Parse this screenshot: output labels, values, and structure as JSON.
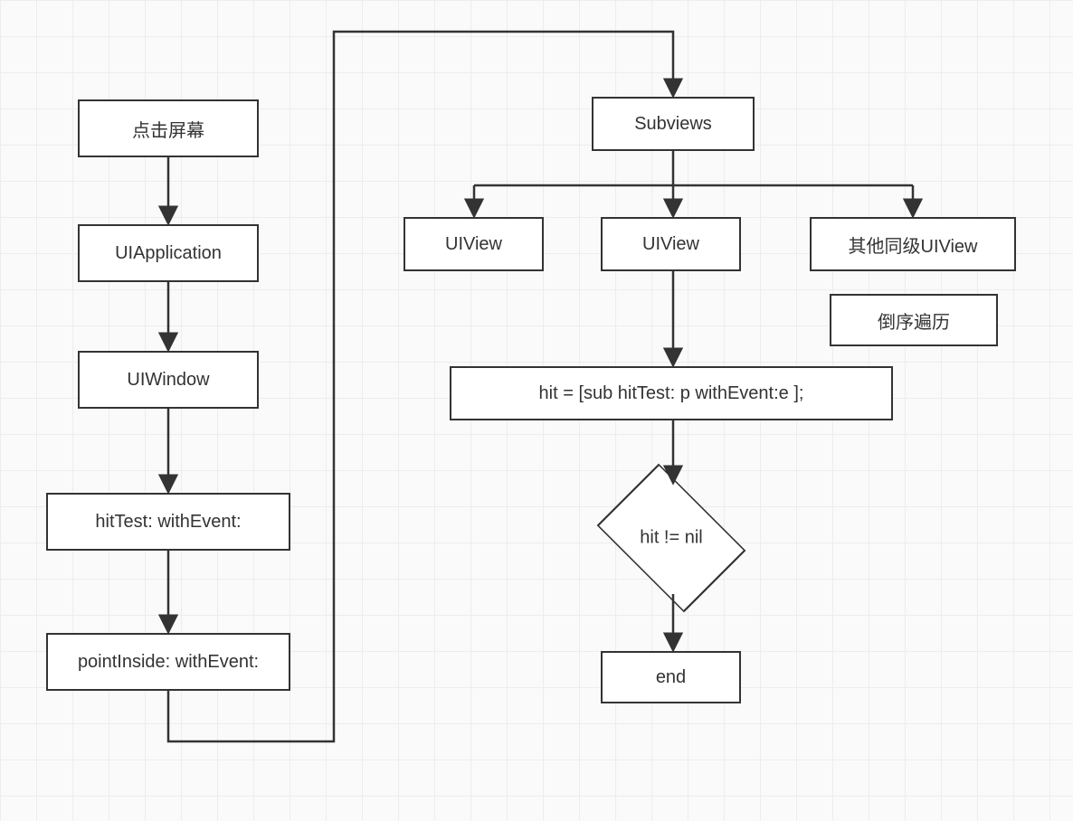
{
  "diagram": {
    "left_chain": {
      "touch_screen": "点击屏幕",
      "uiapplication": "UIApplication",
      "uiwindow": "UIWindow",
      "hittest": "hitTest: withEvent:",
      "pointinside": "pointInside: withEvent:"
    },
    "right_side": {
      "subviews": "Subviews",
      "uiview_left": "UIView",
      "uiview_mid": "UIView",
      "uiview_other": "其他同级UIView",
      "reverse_order": "倒序遍历",
      "hit_assign": "hit = [sub hitTest: p withEvent:e ];",
      "decision": "hit != nil",
      "end": "end"
    }
  },
  "chart_data": {
    "type": "flowchart",
    "nodes": [
      {
        "id": "touch",
        "kind": "process",
        "label": "点击屏幕"
      },
      {
        "id": "uiapp",
        "kind": "process",
        "label": "UIApplication"
      },
      {
        "id": "uiwindow",
        "kind": "process",
        "label": "UIWindow"
      },
      {
        "id": "hittest",
        "kind": "process",
        "label": "hitTest: withEvent:"
      },
      {
        "id": "pointinside",
        "kind": "process",
        "label": "pointInside: withEvent:"
      },
      {
        "id": "subviews",
        "kind": "process",
        "label": "Subviews"
      },
      {
        "id": "uiview_a",
        "kind": "process",
        "label": "UIView"
      },
      {
        "id": "uiview_b",
        "kind": "process",
        "label": "UIView"
      },
      {
        "id": "uiview_other",
        "kind": "process",
        "label": "其他同级UIView"
      },
      {
        "id": "reverse_note",
        "kind": "note",
        "label": "倒序遍历"
      },
      {
        "id": "hit_assign",
        "kind": "process",
        "label": "hit = [sub hitTest: p withEvent:e ];"
      },
      {
        "id": "decision",
        "kind": "decision",
        "label": "hit != nil"
      },
      {
        "id": "end",
        "kind": "terminator",
        "label": "end"
      }
    ],
    "edges": [
      {
        "from": "touch",
        "to": "uiapp"
      },
      {
        "from": "uiapp",
        "to": "uiwindow"
      },
      {
        "from": "uiwindow",
        "to": "hittest"
      },
      {
        "from": "hittest",
        "to": "pointinside"
      },
      {
        "from": "pointinside",
        "to": "subviews"
      },
      {
        "from": "subviews",
        "to": "uiview_a"
      },
      {
        "from": "subviews",
        "to": "uiview_b"
      },
      {
        "from": "subviews",
        "to": "uiview_other"
      },
      {
        "from": "uiview_b",
        "to": "hit_assign"
      },
      {
        "from": "hit_assign",
        "to": "decision"
      },
      {
        "from": "decision",
        "to": "end"
      }
    ]
  }
}
